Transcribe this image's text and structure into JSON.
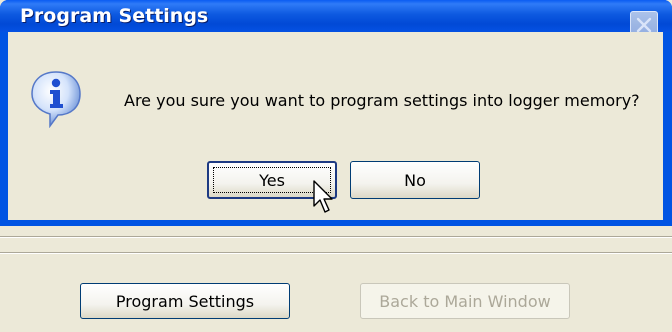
{
  "dialog": {
    "title": "Program Settings",
    "message": "Are you sure you want to program settings into logger memory?",
    "icon": "information-icon",
    "buttons": {
      "yes_label": "Yes",
      "no_label": "No"
    }
  },
  "parent_window": {
    "program_settings_label": "Program Settings",
    "back_label": "Back to Main Window"
  },
  "colors": {
    "titlebar": "#0054e3",
    "window_bg": "#ece9d8",
    "disabled_text": "#aca899"
  }
}
